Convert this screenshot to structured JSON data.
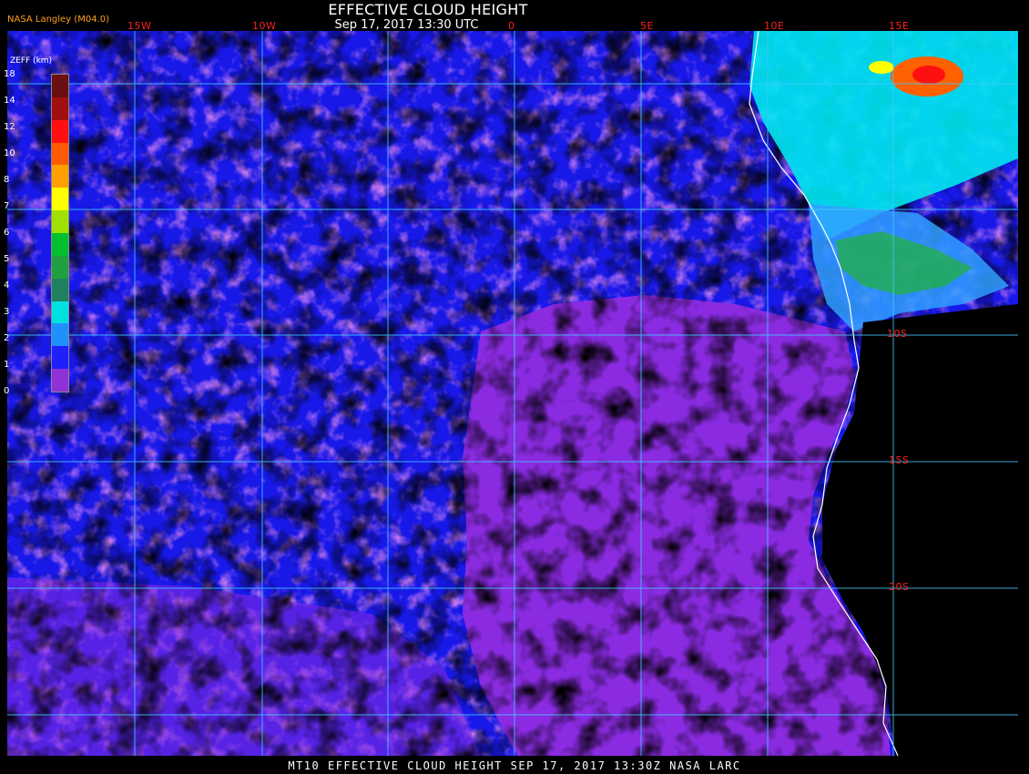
{
  "header": {
    "title": "EFFECTIVE CLOUD HEIGHT",
    "subtitle": "Sep 17, 2017 13:30 UTC",
    "source": "NASA Langley (M04.0)"
  },
  "longitude_labels": [
    "15W",
    "10W",
    "0",
    "5E",
    "10E",
    "15E"
  ],
  "latitude_labels": [
    "10S",
    "15S",
    "20S"
  ],
  "legend": {
    "title": "ZEFF (km)",
    "ticks": [
      "18",
      "14",
      "12",
      "10",
      "8",
      "7",
      "6",
      "5",
      "4",
      "3",
      "2",
      "1",
      "0"
    ],
    "colors": [
      "#6a1010",
      "#a01010",
      "#ff1010",
      "#ff5a00",
      "#ffa000",
      "#ffff00",
      "#a0e000",
      "#00c030",
      "#20a040",
      "#208060",
      "#00e0e0",
      "#2090ff",
      "#2020ff",
      "#9030d8"
    ]
  },
  "footer": "MT10  EFFECTIVE CLOUD HEIGHT  SEP 17, 2017 13:30Z  NASA LARC"
}
